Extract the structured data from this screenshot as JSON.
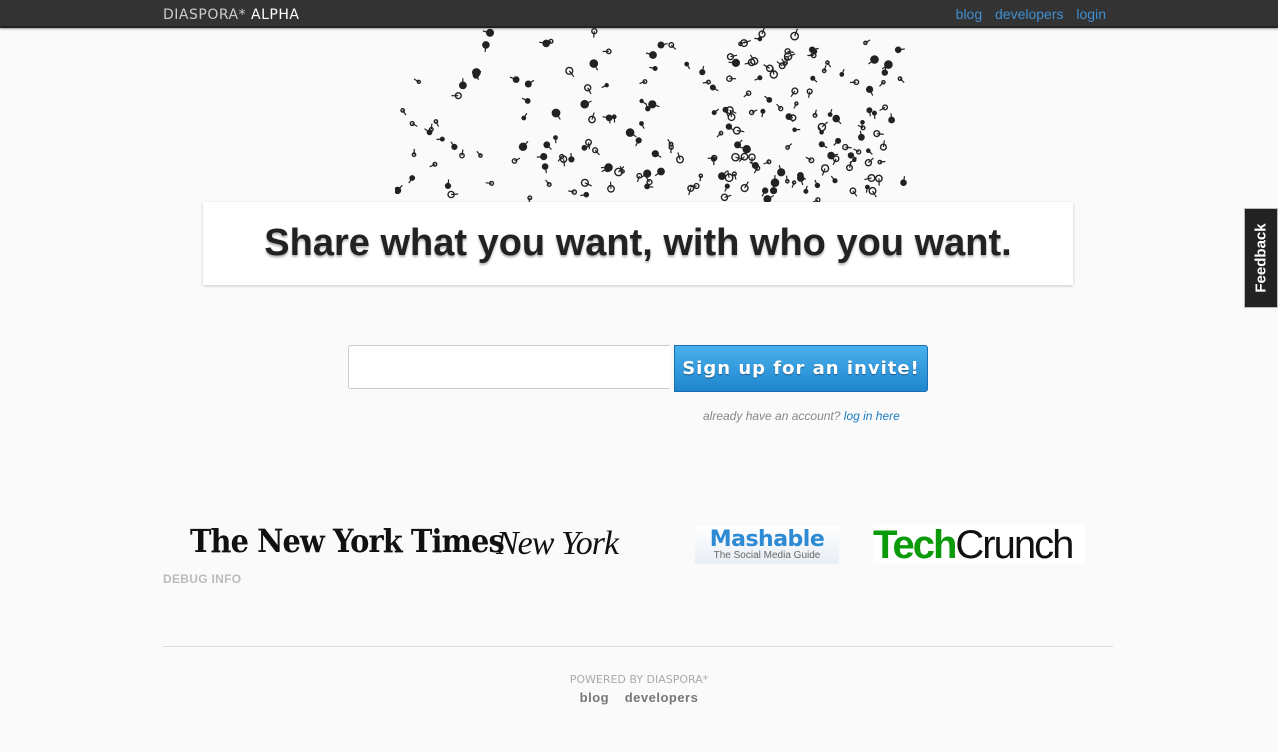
{
  "header": {
    "brand": "DIASPORA*",
    "brand_suffix": "ALPHA",
    "nav": [
      "blog",
      "developers",
      "login"
    ]
  },
  "hero": {
    "tagline": "Share what you want, with who you want."
  },
  "signup": {
    "email_value": "",
    "button_label": "Sign up for an invite!",
    "already_text": "already have an account?",
    "login_link": "log in here"
  },
  "press": {
    "nyt": "The New York Times",
    "nymag": "New York",
    "mashable": "Mashable",
    "mashable_tagline": "The Social Media Guide",
    "techcrunch_tech": "Tech",
    "techcrunch_crunch": "Crunch"
  },
  "debug_label": "DEBUG INFO",
  "footer": {
    "powered": "POWERED BY DIASPORA*",
    "links": [
      "blog",
      "developers"
    ]
  },
  "feedback_label": "Feedback",
  "colors": {
    "topbar": "#333333",
    "link": "#3f8fd2",
    "button": "#1f86cf"
  }
}
